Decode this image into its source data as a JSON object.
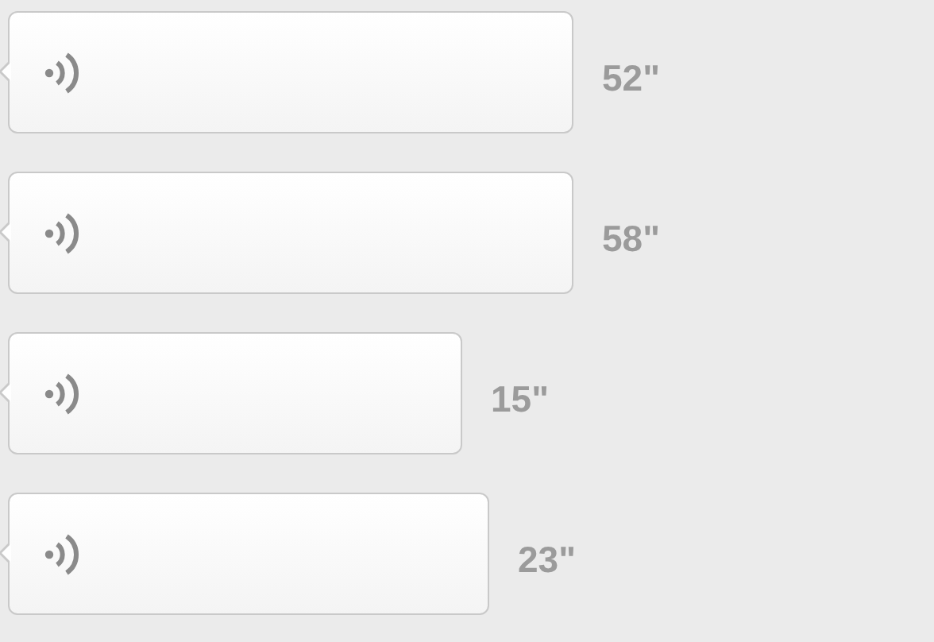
{
  "messages": [
    {
      "duration": "52\""
    },
    {
      "duration": "58\""
    },
    {
      "duration": "15\""
    },
    {
      "duration": "23\""
    }
  ]
}
